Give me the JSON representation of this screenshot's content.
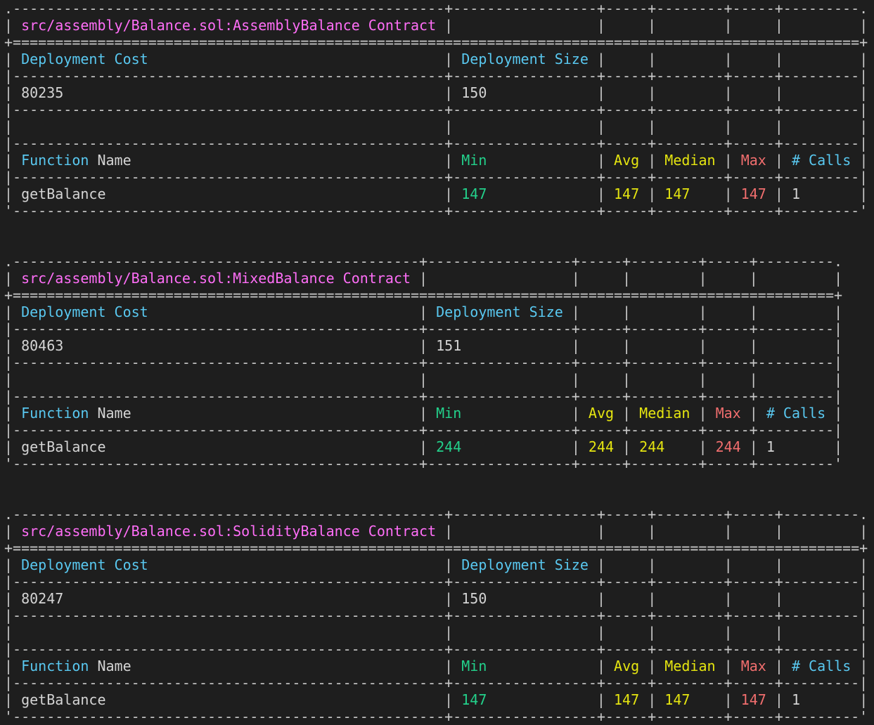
{
  "headers": {
    "deployment_cost": "Deployment Cost",
    "deployment_size": "Deployment Size",
    "function": "Function",
    "name": "Name",
    "min": "Min",
    "avg": "Avg",
    "median": "Median",
    "max": "Max",
    "calls_hash": "#",
    "calls": "Calls"
  },
  "tables": [
    {
      "contract_path": "src/assembly/Balance.sol:AssemblyBalance",
      "contract_word": "Contract",
      "deployment_cost": "80235",
      "deployment_size": "150",
      "function_name": "getBalance",
      "min": "147",
      "avg": "147",
      "median": "147",
      "max": "147",
      "calls": "1"
    },
    {
      "contract_path": "src/assembly/Balance.sol:MixedBalance",
      "contract_word": "Contract",
      "deployment_cost": "80463",
      "deployment_size": "151",
      "function_name": "getBalance",
      "min": "244",
      "avg": "244",
      "median": "244",
      "max": "244",
      "calls": "1"
    },
    {
      "contract_path": "src/assembly/Balance.sol:SolidityBalance",
      "contract_word": "Contract",
      "deployment_cost": "80247",
      "deployment_size": "150",
      "function_name": "getBalance",
      "min": "147",
      "avg": "147",
      "median": "147",
      "max": "147",
      "calls": "1"
    }
  ],
  "colors": {
    "background": "#1e1e1e",
    "title": "#ff6ef7",
    "header": "#59c8f0",
    "min": "#23d18b",
    "avg_median": "#e5e510",
    "max": "#f16e6e"
  }
}
